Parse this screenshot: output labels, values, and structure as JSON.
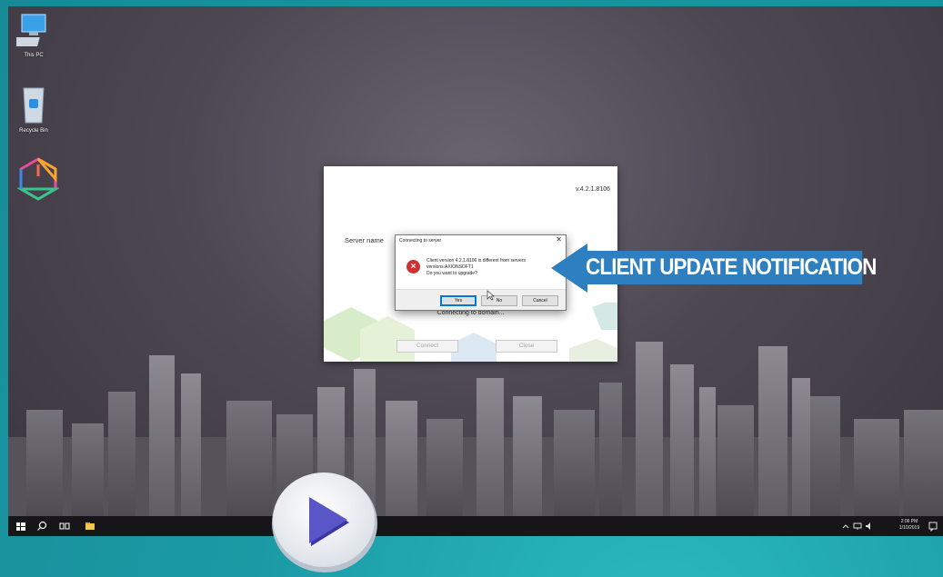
{
  "desktop": {
    "icons": [
      {
        "label": "This PC",
        "icon": "computer-icon"
      },
      {
        "label": "Recycle Bin",
        "icon": "recycle-bin-icon"
      },
      {
        "label": "",
        "icon": "hexagon-power-icon"
      }
    ]
  },
  "app_window": {
    "version": "v.4.2.1.8106",
    "server_label": "Server name",
    "status": "Connecting to domain...",
    "connect_label": "Connect",
    "close_label": "Close"
  },
  "dialog": {
    "title": "Connecting to server",
    "close_glyph": "✕",
    "icon": "error-icon",
    "message_lines": [
      "Client version 4.2.1.8106 is different from servers",
      "versions:AXIONSOFT1",
      "Do you want to upgrade?"
    ],
    "yes_label": "Yes",
    "no_label": "No",
    "cancel_label": "Cancel"
  },
  "callout": {
    "text": "CLIENT UPDATE NOTIFICATION",
    "color": "#2d7fc0"
  },
  "taskbar": {
    "time": "2:06 PM",
    "date": "1/10/2019"
  },
  "colors": {
    "accent": "#1fa3ac",
    "error": "#d42f2f",
    "play": "#5a56c8"
  }
}
